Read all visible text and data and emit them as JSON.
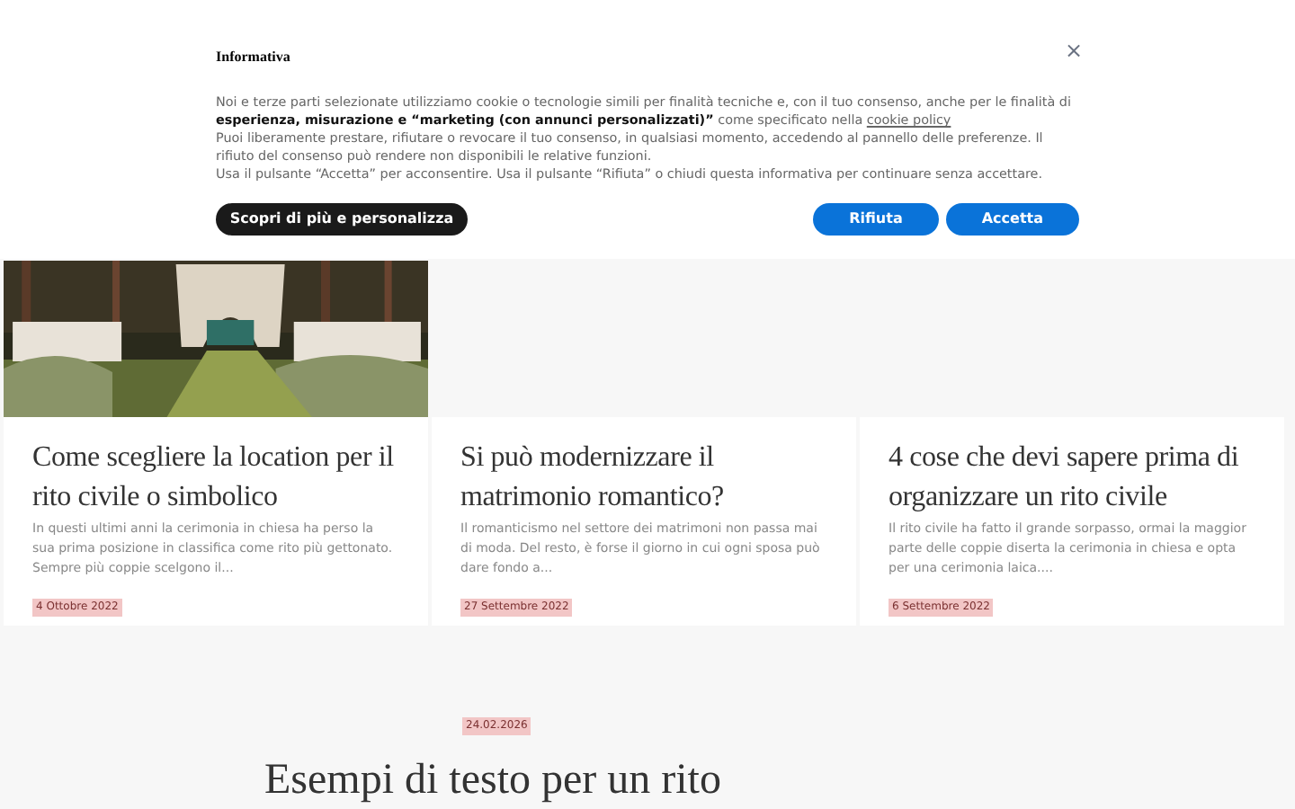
{
  "cookie_banner": {
    "title": "Informativa",
    "close": "×",
    "paragraphs": [
      {
        "text": "Noi e terze parti selezionate utilizziamo cookie o tecnologie simili per finalità tecniche e, con il tuo consenso, anche per le finalità di **esperienza, misurazione e “marketing (con annunci personalizzati)”** come specificato nella",
        "link": "cookie policy"
      },
      {
        "text": "Puoi liberamente prestare, rifiutare o revocare il tuo consenso, in qualsiasi momento, accedendo al pannello delle preferenze. Il rifiuto del consenso può rendere non disponibili le relative funzioni."
      },
      {
        "text": "Usa il pulsante “Accetta” per acconsentire. Usa il pulsante “Rifiuta” o chiudi questa informativa per continuare senza accettare."
      }
    ],
    "buttons": [
      {
        "label": "Scopri di più e personalizza",
        "kind": "secondary"
      },
      {
        "label": "Rifiuta",
        "kind": "primary"
      },
      {
        "label": "Accetta",
        "kind": "primary"
      }
    ]
  },
  "posts": [
    {
      "title": "Come scegliere la location per il rito civile o simbolico",
      "excerpt": "In questi ultimi anni la cerimonia in chiesa ha perso la sua prima posizione in classifica come rito più gettonato. Sempre più coppie scelgono il...",
      "date": "4 Ottobre 2022"
    },
    {
      "title": "Si può modernizzare il matrimonio romantico?",
      "excerpt": "Il romanticismo nel settore dei matrimoni non passa mai di moda. Del resto, è forse il giorno in cui ogni sposa può dare fondo a...",
      "date": "27 Settembre 2022"
    },
    {
      "title": "4 cose che devi sapere prima di organizzare un rito civile",
      "excerpt": "Il rito civile ha fatto il grande sorpasso, ormai la maggior parte delle coppie diserta la cerimonia in chiesa e opta per una cerimonia laica....",
      "date": "6 Settembre 2022"
    }
  ],
  "featured": {
    "date": "24.02.2026",
    "title": "Esempi di testo per un rito"
  }
}
